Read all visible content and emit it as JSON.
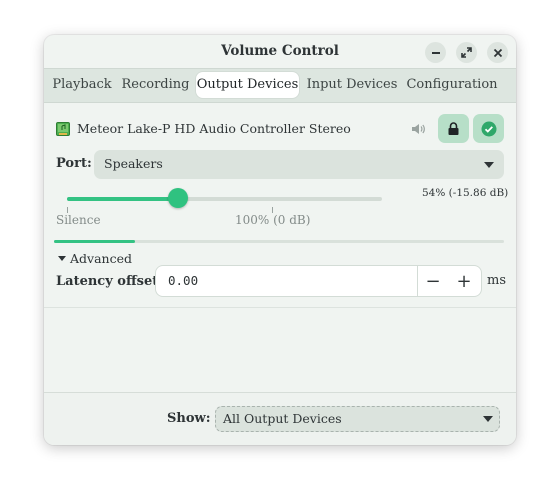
{
  "window": {
    "title": "Volume Control",
    "controls": [
      "minimize-icon",
      "maximize-icon",
      "close-icon"
    ]
  },
  "tabs": [
    {
      "label": "Playback",
      "active": false
    },
    {
      "label": "Recording",
      "active": false
    },
    {
      "label": "Output Devices",
      "active": true
    },
    {
      "label": "Input Devices",
      "active": false
    },
    {
      "label": "Configuration",
      "active": false
    }
  ],
  "device": {
    "name": "Meteor Lake-P HD Audio Controller Stereo",
    "icon": "audio-card-icon",
    "mute_icon": "speaker-icon",
    "lock_icon": "lock-icon",
    "default_icon": "check-circle-icon",
    "port_label": "Port:",
    "port_value": "Speakers",
    "volume_readout": "54% (-15.86 dB)",
    "volume_percent": 54,
    "silence_label": "Silence",
    "normal_label": "100% (0 dB)",
    "peak_level": 0.18,
    "advanced_label": "Advanced",
    "latency_label": "Latency offset:",
    "latency_value": "0.00",
    "latency_unit": "ms",
    "minus": "−",
    "plus": "+"
  },
  "footer": {
    "show_label": "Show:",
    "show_value": "All Output Devices"
  },
  "colors": {
    "accent": "#2fc280",
    "accent_light": "#b7dfc8",
    "window_bg": "#f0f4f1",
    "tabbar_bg": "#dde6e0"
  }
}
